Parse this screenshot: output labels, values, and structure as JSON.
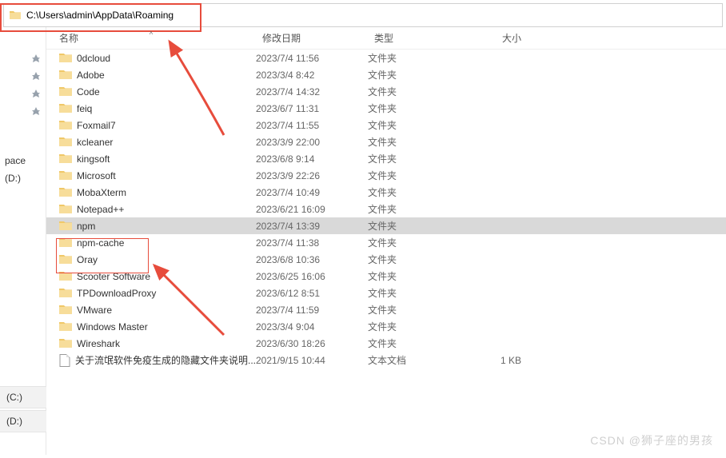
{
  "address": {
    "path": "C:\\Users\\admin\\AppData\\Roaming"
  },
  "columns": {
    "name": "名称",
    "date": "修改日期",
    "type": "类型",
    "size": "大小"
  },
  "type_labels": {
    "folder": "文件夹",
    "textdoc": "文本文档"
  },
  "items": [
    {
      "name": "0dcloud",
      "date": "2023/7/4 11:56",
      "kind": "folder",
      "size": ""
    },
    {
      "name": "Adobe",
      "date": "2023/3/4 8:42",
      "kind": "folder",
      "size": ""
    },
    {
      "name": "Code",
      "date": "2023/7/4 14:32",
      "kind": "folder",
      "size": ""
    },
    {
      "name": "feiq",
      "date": "2023/6/7 11:31",
      "kind": "folder",
      "size": ""
    },
    {
      "name": "Foxmail7",
      "date": "2023/7/4 11:55",
      "kind": "folder",
      "size": ""
    },
    {
      "name": "kcleaner",
      "date": "2023/3/9 22:00",
      "kind": "folder",
      "size": ""
    },
    {
      "name": "kingsoft",
      "date": "2023/6/8 9:14",
      "kind": "folder",
      "size": ""
    },
    {
      "name": "Microsoft",
      "date": "2023/3/9 22:26",
      "kind": "folder",
      "size": ""
    },
    {
      "name": "MobaXterm",
      "date": "2023/7/4 10:49",
      "kind": "folder",
      "size": ""
    },
    {
      "name": "Notepad++",
      "date": "2023/6/21 16:09",
      "kind": "folder",
      "size": ""
    },
    {
      "name": "npm",
      "date": "2023/7/4 13:39",
      "kind": "folder",
      "size": "",
      "selected": true
    },
    {
      "name": "npm-cache",
      "date": "2023/7/4 11:38",
      "kind": "folder",
      "size": ""
    },
    {
      "name": "Oray",
      "date": "2023/6/8 10:36",
      "kind": "folder",
      "size": ""
    },
    {
      "name": "Scooter Software",
      "date": "2023/6/25 16:06",
      "kind": "folder",
      "size": ""
    },
    {
      "name": "TPDownloadProxy",
      "date": "2023/6/12 8:51",
      "kind": "folder",
      "size": ""
    },
    {
      "name": "VMware",
      "date": "2023/7/4 11:59",
      "kind": "folder",
      "size": ""
    },
    {
      "name": "Windows Master",
      "date": "2023/3/4 9:04",
      "kind": "folder",
      "size": ""
    },
    {
      "name": "Wireshark",
      "date": "2023/6/30 18:26",
      "kind": "folder",
      "size": ""
    },
    {
      "name": "关于流氓软件免疫生成的隐藏文件夹说明...",
      "date": "2021/9/15 10:44",
      "kind": "textdoc",
      "size": "1 KB"
    }
  ],
  "sidebar": {
    "upper_labels": [
      "pace",
      " (D:)"
    ],
    "bottom_labels": [
      " (C:)",
      " (D:)"
    ]
  },
  "watermark": "CSDN @狮子座的男孩"
}
